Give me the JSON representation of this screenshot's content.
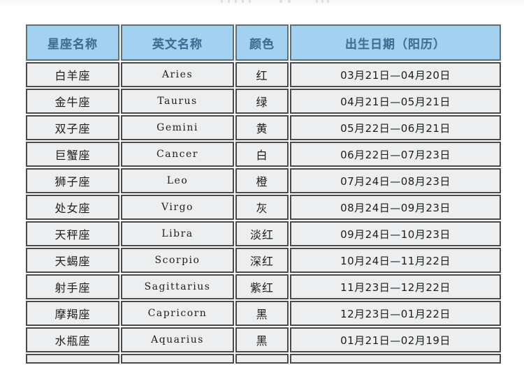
{
  "page": {
    "background_color": "#ffffff",
    "top_remnant_note": ""
  },
  "table": {
    "header_background": "#a3d1f0",
    "header_text_color": "#3e6d93",
    "cell_background": "#eceeef",
    "border_color": "#4a4a4a",
    "columns": [
      {
        "key": "name",
        "label": "星座名称"
      },
      {
        "key": "en",
        "label": "英文名称"
      },
      {
        "key": "color",
        "label": "颜色"
      },
      {
        "key": "date",
        "label": "出生日期（阳历）"
      }
    ],
    "rows": [
      {
        "name": "白羊座",
        "en": "Aries",
        "color": "红",
        "date": "03月21日—04月20日"
      },
      {
        "name": "金牛座",
        "en": "Taurus",
        "color": "绿",
        "date": "04月21日—05月21日"
      },
      {
        "name": "双子座",
        "en": "Gemini",
        "color": "黄",
        "date": "05月22日—06月21日"
      },
      {
        "name": "巨蟹座",
        "en": "Cancer",
        "color": "白",
        "date": "06月22日—07月23日"
      },
      {
        "name": "狮子座",
        "en": "Leo",
        "color": "橙",
        "date": "07月24日—08月23日"
      },
      {
        "name": "处女座",
        "en": "Virgo",
        "color": "灰",
        "date": "08月24日—09月23日"
      },
      {
        "name": "天秤座",
        "en": "Libra",
        "color": "淡红",
        "date": "09月24日—10月23日"
      },
      {
        "name": "天蝎座",
        "en": "Scorpio",
        "color": "深红",
        "date": "10月24日—11月22日"
      },
      {
        "name": "射手座",
        "en": "Sagittarius",
        "color": "紫红",
        "date": "11月23日—12月22日"
      },
      {
        "name": "摩羯座",
        "en": "Capricorn",
        "color": "黑",
        "date": "12月23日—01月22日"
      },
      {
        "name": "水瓶座",
        "en": "Aquarius",
        "color": "黑",
        "date": "01月21日—02月19日"
      },
      {
        "name": "",
        "en": "",
        "color": "",
        "date": ""
      }
    ]
  }
}
